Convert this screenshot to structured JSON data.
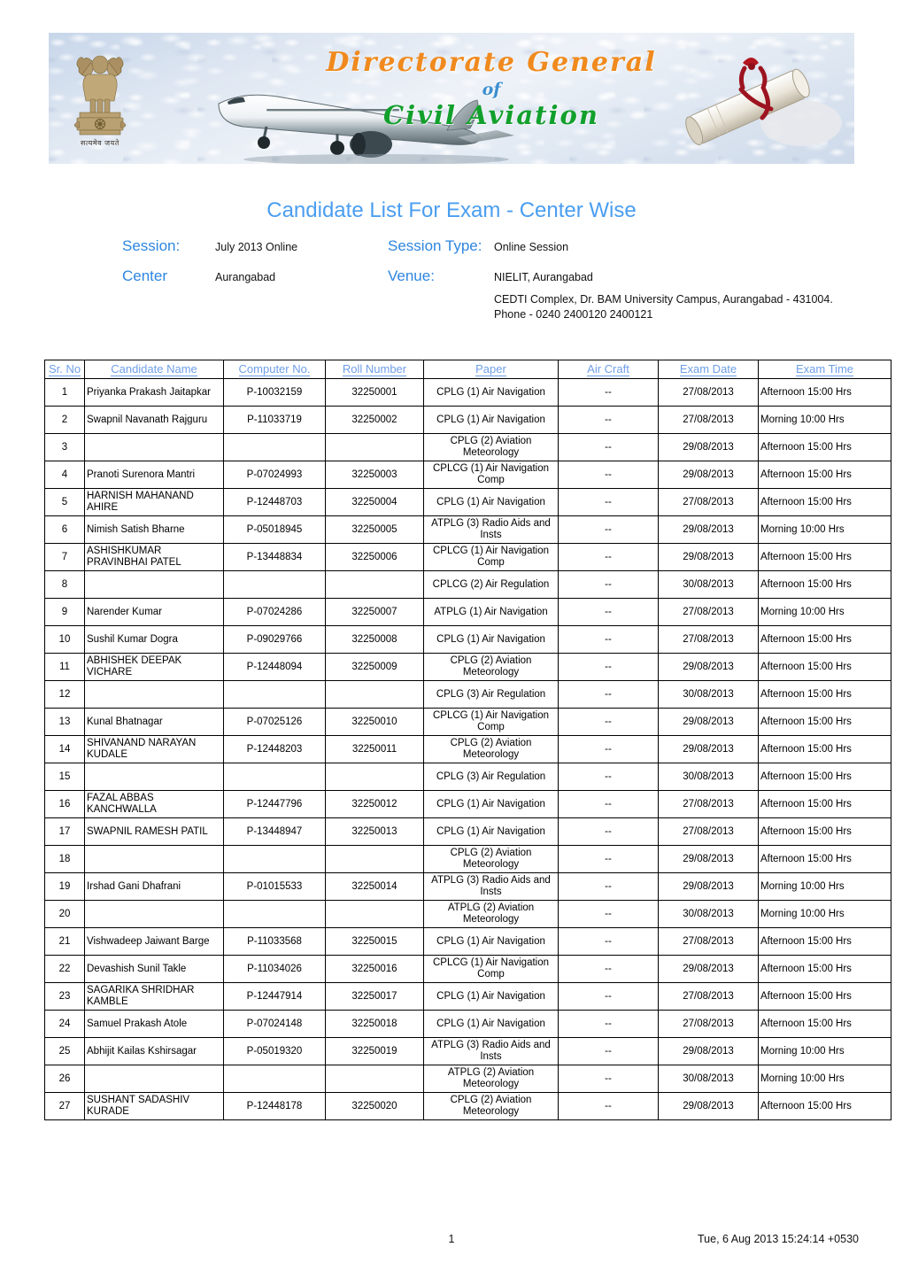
{
  "banner": {
    "line1": "Directorate General",
    "line2": "of",
    "line3": "Civil Aviation",
    "emblem_caption": "सत्यमेव जयते",
    "emblem_name": "national-emblem-of-india",
    "colors": {
      "line1": "#f08a1e",
      "line2": "#3a8fd0",
      "line3": "#12a02c"
    }
  },
  "page": {
    "title": "Candidate List For Exam - Center Wise",
    "title_color": "#4a9ef0",
    "label_color": "#2e86e0"
  },
  "meta": {
    "session_label": "Session:",
    "session_value": "July 2013 Online",
    "session_type_label": "Session Type:",
    "session_type_value": "Online Session",
    "center_label": "Center",
    "center_value": "Aurangabad",
    "venue_label": "Venue:",
    "venue_value": "NIELIT, Aurangabad",
    "venue_address": "CEDTI Complex, Dr. BAM University Campus, Aurangabad - 431004. Phone - 0240 2400120 2400121"
  },
  "table": {
    "headers": [
      "Sr. No",
      "Candidate Name",
      "Computer No.",
      "Roll Number",
      "Paper",
      "Air Craft",
      "Exam Date",
      "Exam Time"
    ],
    "rows": [
      {
        "sr": "1",
        "name": "Priyanka Prakash Jaitapkar",
        "computer": "P-10032159",
        "roll": "32250001",
        "paper": "CPLG (1) Air Navigation",
        "aircraft": "--",
        "date": "27/08/2013",
        "time": "Afternoon 15:00 Hrs"
      },
      {
        "sr": "2",
        "name": "Swapnil Navanath Rajguru",
        "computer": "P-11033719",
        "roll": "32250002",
        "paper": "CPLG (1) Air Navigation",
        "aircraft": "--",
        "date": "27/08/2013",
        "time": "Morning 10:00 Hrs"
      },
      {
        "sr": "3",
        "name": "",
        "computer": "",
        "roll": "",
        "paper": "CPLG (2) Aviation Meteorology",
        "aircraft": "--",
        "date": "29/08/2013",
        "time": "Afternoon 15:00 Hrs"
      },
      {
        "sr": "4",
        "name": "Pranoti Surenora Mantri",
        "computer": "P-07024993",
        "roll": "32250003",
        "paper": "CPLCG (1) Air Navigation Comp",
        "aircraft": "--",
        "date": "29/08/2013",
        "time": "Afternoon 15:00 Hrs"
      },
      {
        "sr": "5",
        "name": "HARNISH MAHANAND AHIRE",
        "computer": "P-12448703",
        "roll": "32250004",
        "paper": "CPLG (1) Air Navigation",
        "aircraft": "--",
        "date": "27/08/2013",
        "time": "Afternoon 15:00 Hrs"
      },
      {
        "sr": "6",
        "name": "Nimish Satish Bharne",
        "computer": "P-05018945",
        "roll": "32250005",
        "paper": "ATPLG (3) Radio Aids and Insts",
        "aircraft": "--",
        "date": "29/08/2013",
        "time": "Morning 10:00 Hrs"
      },
      {
        "sr": "7",
        "name": "ASHISHKUMAR PRAVINBHAI PATEL",
        "computer": "P-13448834",
        "roll": "32250006",
        "paper": "CPLCG (1) Air Navigation Comp",
        "aircraft": "--",
        "date": "29/08/2013",
        "time": "Afternoon 15:00 Hrs"
      },
      {
        "sr": "8",
        "name": "",
        "computer": "",
        "roll": "",
        "paper": "CPLCG (2) Air Regulation",
        "aircraft": "--",
        "date": "30/08/2013",
        "time": "Afternoon 15:00 Hrs"
      },
      {
        "sr": "9",
        "name": "Narender Kumar",
        "computer": "P-07024286",
        "roll": "32250007",
        "paper": "ATPLG (1) Air Navigation",
        "aircraft": "--",
        "date": "27/08/2013",
        "time": "Morning 10:00 Hrs"
      },
      {
        "sr": "10",
        "name": "Sushil Kumar Dogra",
        "computer": "P-09029766",
        "roll": "32250008",
        "paper": "CPLG (1) Air Navigation",
        "aircraft": "--",
        "date": "27/08/2013",
        "time": "Afternoon 15:00 Hrs"
      },
      {
        "sr": "11",
        "name": "ABHISHEK DEEPAK VICHARE",
        "computer": "P-12448094",
        "roll": "32250009",
        "paper": "CPLG (2) Aviation Meteorology",
        "aircraft": "--",
        "date": "29/08/2013",
        "time": "Afternoon 15:00 Hrs"
      },
      {
        "sr": "12",
        "name": "",
        "computer": "",
        "roll": "",
        "paper": "CPLG (3) Air Regulation",
        "aircraft": "--",
        "date": "30/08/2013",
        "time": "Afternoon 15:00 Hrs"
      },
      {
        "sr": "13",
        "name": "Kunal Bhatnagar",
        "computer": "P-07025126",
        "roll": "32250010",
        "paper": "CPLCG (1) Air Navigation Comp",
        "aircraft": "--",
        "date": "29/08/2013",
        "time": "Afternoon 15:00 Hrs"
      },
      {
        "sr": "14",
        "name": "SHIVANAND NARAYAN KUDALE",
        "computer": "P-12448203",
        "roll": "32250011",
        "paper": "CPLG (2) Aviation Meteorology",
        "aircraft": "--",
        "date": "29/08/2013",
        "time": "Afternoon 15:00 Hrs"
      },
      {
        "sr": "15",
        "name": "",
        "computer": "",
        "roll": "",
        "paper": "CPLG (3) Air Regulation",
        "aircraft": "--",
        "date": "30/08/2013",
        "time": "Afternoon 15:00 Hrs"
      },
      {
        "sr": "16",
        "name": "FAZAL ABBAS KANCHWALLA",
        "computer": "P-12447796",
        "roll": "32250012",
        "paper": "CPLG (1) Air Navigation",
        "aircraft": "--",
        "date": "27/08/2013",
        "time": "Afternoon 15:00 Hrs"
      },
      {
        "sr": "17",
        "name": "SWAPNIL RAMESH PATIL",
        "computer": "P-13448947",
        "roll": "32250013",
        "paper": "CPLG (1) Air Navigation",
        "aircraft": "--",
        "date": "27/08/2013",
        "time": "Afternoon 15:00 Hrs"
      },
      {
        "sr": "18",
        "name": "",
        "computer": "",
        "roll": "",
        "paper": "CPLG (2) Aviation Meteorology",
        "aircraft": "--",
        "date": "29/08/2013",
        "time": "Afternoon 15:00 Hrs"
      },
      {
        "sr": "19",
        "name": "Irshad Gani Dhafrani",
        "computer": "P-01015533",
        "roll": "32250014",
        "paper": "ATPLG (3) Radio Aids and Insts",
        "aircraft": "--",
        "date": "29/08/2013",
        "time": "Morning 10:00 Hrs"
      },
      {
        "sr": "20",
        "name": "",
        "computer": "",
        "roll": "",
        "paper": "ATPLG (2) Aviation Meteorology",
        "aircraft": "--",
        "date": "30/08/2013",
        "time": "Morning 10:00 Hrs"
      },
      {
        "sr": "21",
        "name": "Vishwadeep Jaiwant Barge",
        "computer": "P-11033568",
        "roll": "32250015",
        "paper": "CPLG (1) Air Navigation",
        "aircraft": "--",
        "date": "27/08/2013",
        "time": "Afternoon 15:00 Hrs"
      },
      {
        "sr": "22",
        "name": "Devashish Sunil Takle",
        "computer": "P-11034026",
        "roll": "32250016",
        "paper": "CPLCG (1) Air Navigation Comp",
        "aircraft": "--",
        "date": "29/08/2013",
        "time": "Afternoon 15:00 Hrs"
      },
      {
        "sr": "23",
        "name": "SAGARIKA SHRIDHAR KAMBLE",
        "computer": "P-12447914",
        "roll": "32250017",
        "paper": "CPLG (1) Air Navigation",
        "aircraft": "--",
        "date": "27/08/2013",
        "time": "Afternoon 15:00 Hrs"
      },
      {
        "sr": "24",
        "name": "Samuel Prakash Atole",
        "computer": "P-07024148",
        "roll": "32250018",
        "paper": "CPLG (1) Air Navigation",
        "aircraft": "--",
        "date": "27/08/2013",
        "time": "Afternoon 15:00 Hrs"
      },
      {
        "sr": "25",
        "name": "Abhijit Kailas Kshirsagar",
        "computer": "P-05019320",
        "roll": "32250019",
        "paper": "ATPLG (3) Radio Aids and Insts",
        "aircraft": "--",
        "date": "29/08/2013",
        "time": "Morning 10:00 Hrs"
      },
      {
        "sr": "26",
        "name": "",
        "computer": "",
        "roll": "",
        "paper": "ATPLG (2) Aviation Meteorology",
        "aircraft": "--",
        "date": "30/08/2013",
        "time": "Morning 10:00 Hrs"
      },
      {
        "sr": "27",
        "name": "SUSHANT SADASHIV KURADE",
        "computer": "P-12448178",
        "roll": "32250020",
        "paper": "CPLG (2) Aviation Meteorology",
        "aircraft": "--",
        "date": "29/08/2013",
        "time": "Afternoon 15:00 Hrs"
      }
    ]
  },
  "footer": {
    "page_number": "1",
    "timestamp": "Tue, 6 Aug 2013 15:24:14 +0530"
  }
}
